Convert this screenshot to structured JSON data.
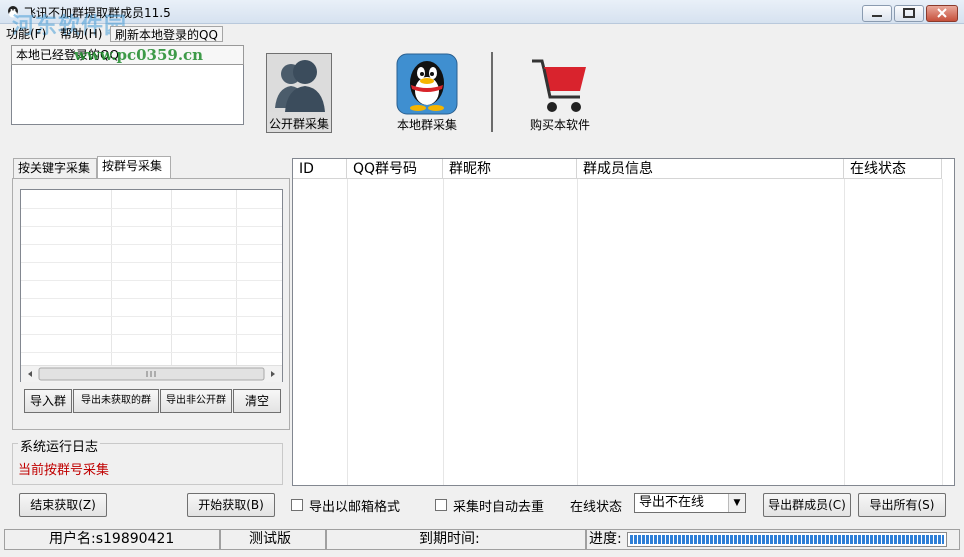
{
  "window": {
    "title": "飞讯不加群提取群成员11.5",
    "watermark": "河东软件园",
    "watermark_url": "www.pc0359.cn"
  },
  "menu": {
    "items": [
      "功能(F)",
      "帮助(H)",
      "刷新本地登录的QQ"
    ]
  },
  "login_panel": {
    "header": "本地已经登录的QQ"
  },
  "toolbar": {
    "public_collect": "公开群采集",
    "local_collect": "本地群采集",
    "buy": "购买本软件"
  },
  "left_tabs": [
    "按关键字采集",
    "按群号采集"
  ],
  "left_buttons": {
    "import": "导入群",
    "export_unfetched": "导出未获取的群",
    "export_nonpublic": "导出非公开群",
    "clear": "清空"
  },
  "log": {
    "label": "系统运行日志",
    "message": "当前按群号采集"
  },
  "grid": {
    "columns": [
      "ID",
      "QQ群号码",
      "群昵称",
      "群成员信息",
      "在线状态"
    ]
  },
  "bottom": {
    "stop": "结束获取(Z)",
    "start": "开始获取(B)",
    "email_format": "导出以邮箱格式",
    "auto_dedupe": "采集时自动去重",
    "online_label": "在线状态",
    "online_value": "导出不在线",
    "export_members": "导出群成员(C)",
    "export_all": "导出所有(S)"
  },
  "statusbar": {
    "username": "用户名:s19890421",
    "edition": "测试版",
    "expire": "到期时间:",
    "progress_label": "进度:",
    "progress_value": 1.0
  },
  "colors": {
    "log_text": "#c00000",
    "progress": "#2f7fd6",
    "cart": "#d9232d"
  }
}
